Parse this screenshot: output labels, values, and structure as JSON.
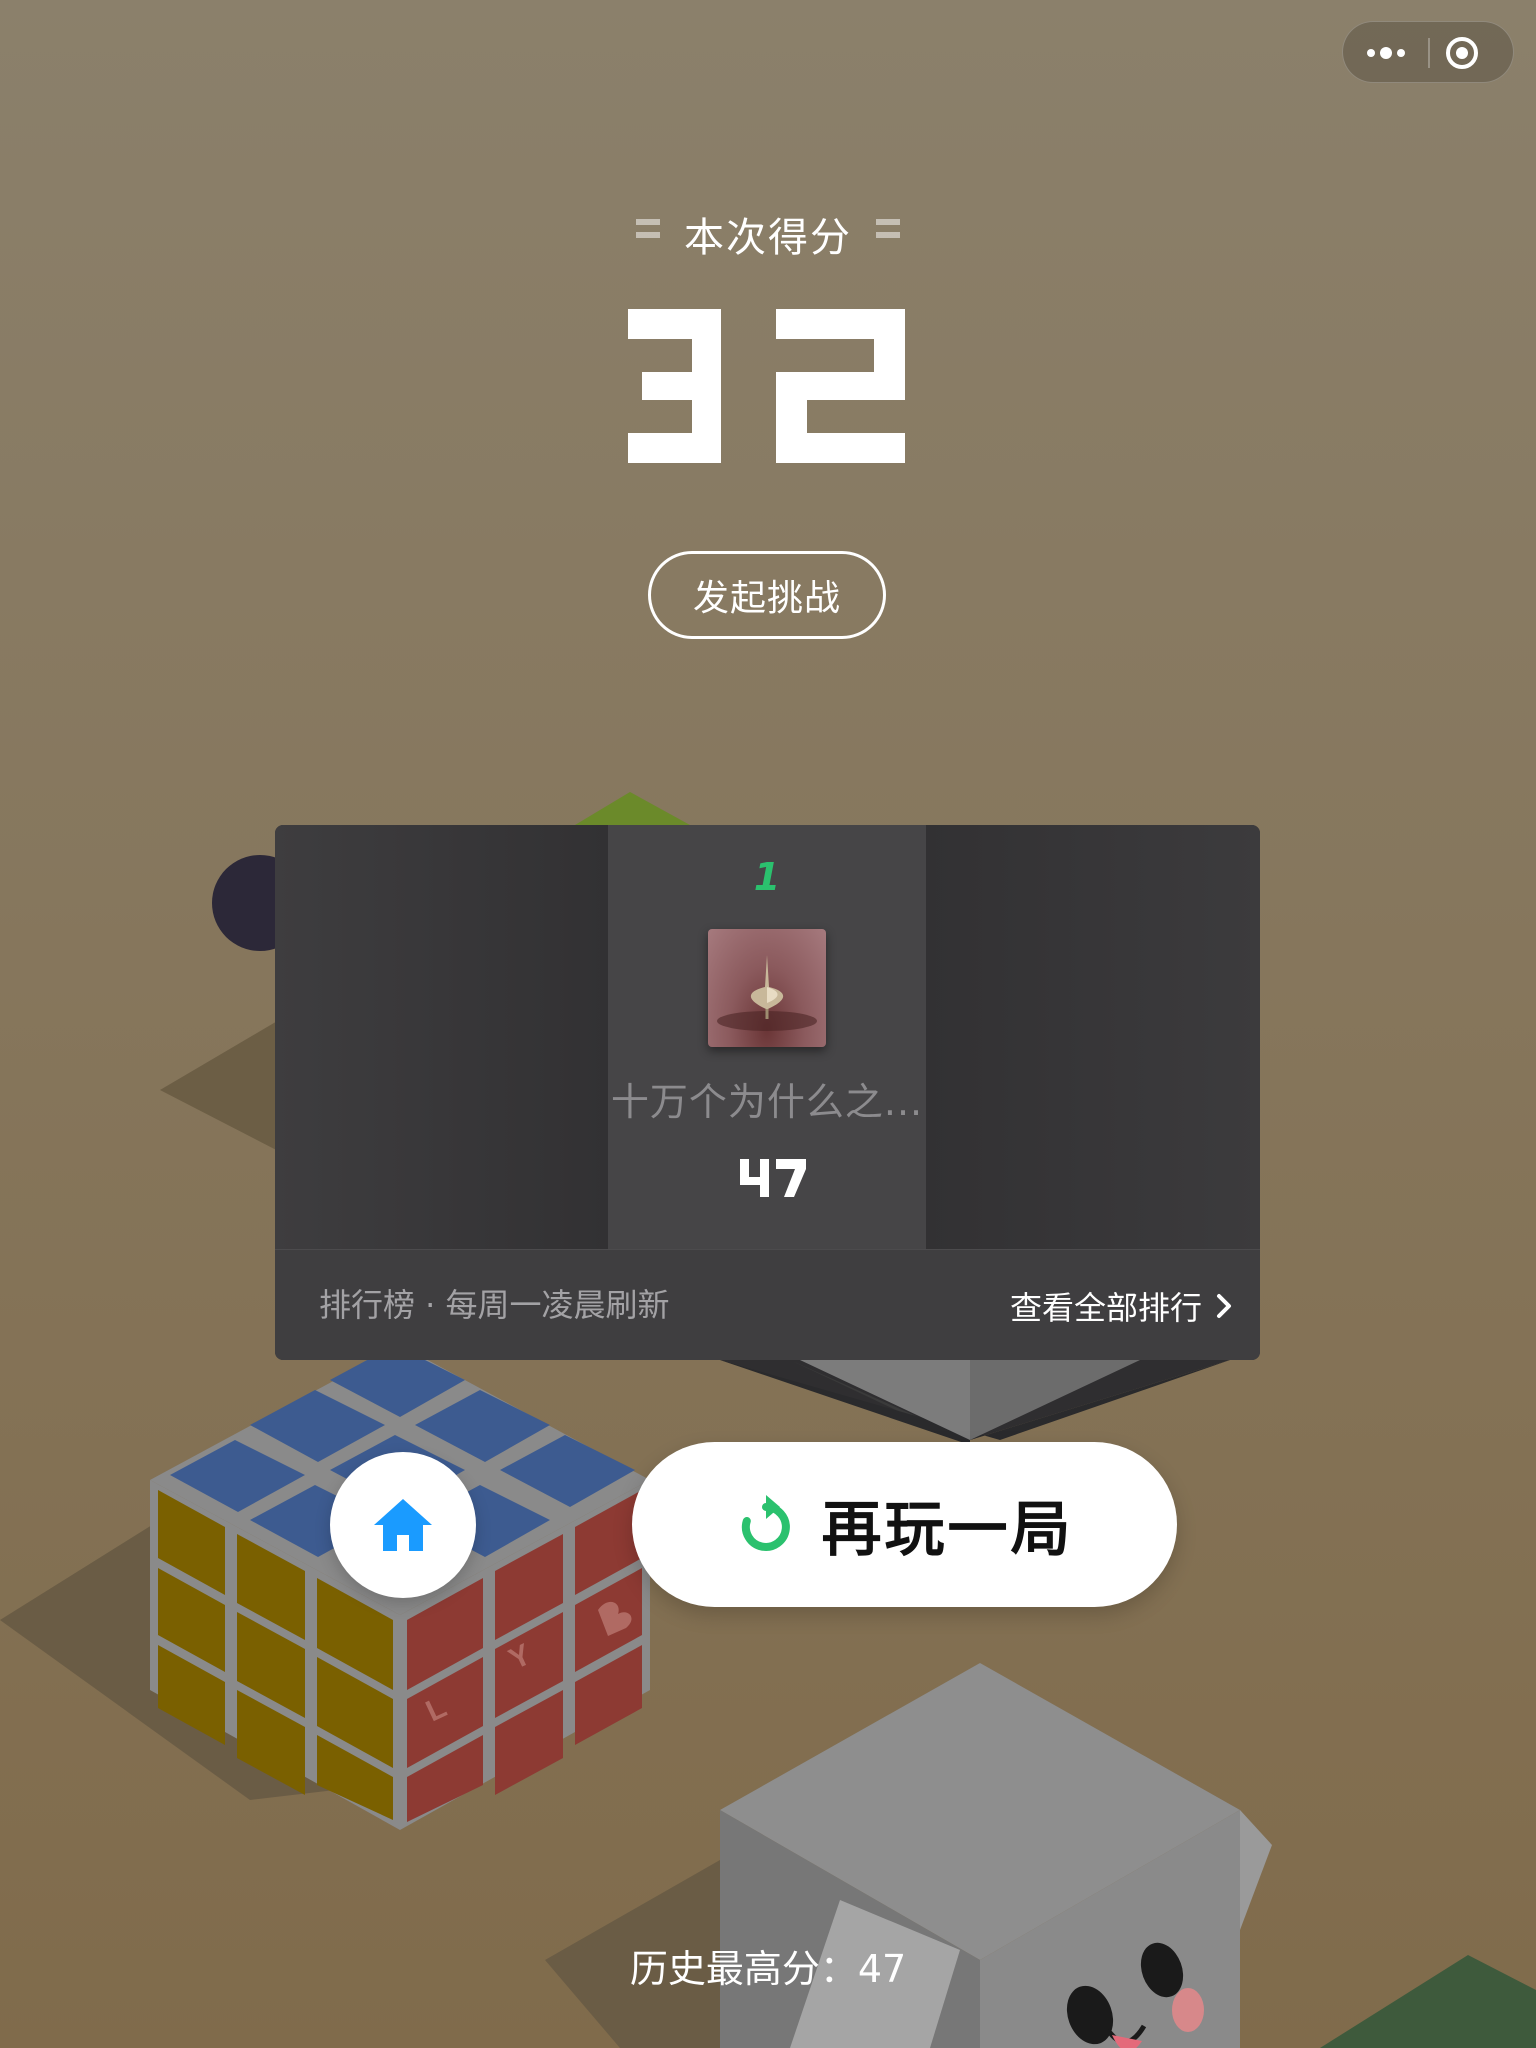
{
  "header": {
    "score_label": "本次得分",
    "current_score": "32",
    "challenge_button": "发起挑战"
  },
  "capsule": {
    "more_icon": "more-dots-icon",
    "close_icon": "target-circle-icon"
  },
  "leaderboard": {
    "entries": [
      {
        "rank": "1",
        "name": "十万个为什么之...",
        "score": "47",
        "avatar": "spinning-top-photo"
      }
    ],
    "footer_left": "排行榜 · 每周一凌晨刷新",
    "footer_right": "查看全部排行"
  },
  "actions": {
    "home_icon": "home-icon",
    "replay_icon": "replay-icon",
    "replay_label": "再玩一局"
  },
  "best_score": "历史最高分：47",
  "colors": {
    "accent_green": "#2bc16e",
    "home_blue": "#1a9bff",
    "board_bg": "#3b3a3c"
  }
}
